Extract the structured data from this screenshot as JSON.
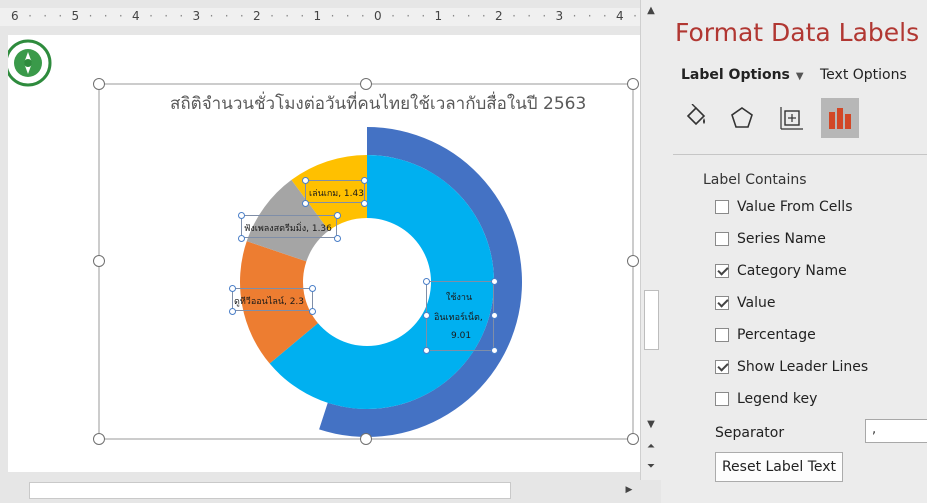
{
  "ruler": {
    "labels": [
      "6",
      "5",
      "4",
      "3",
      "2",
      "1",
      "0",
      "1",
      "2",
      "3",
      "4"
    ]
  },
  "slide": {
    "title": "สถิติจำนวนชั่วโมงต่อวันที่คนไทยใช้เวลากับสื่อในปี 2563"
  },
  "chart_data": {
    "type": "pie",
    "subtype": "doughnut",
    "title": "สถิติจำนวนชั่วโมงต่อวันที่คนไทยใช้เวลากับสื่อในปี 2563",
    "series": [
      {
        "categories": [
          "ใช้งานอินเทอร์เน็ต",
          "ดูทีวีออนไลน์",
          "ฟังเพลงสตรีมมิ่ง",
          "เล่นเกม"
        ],
        "values": [
          9.01,
          2.3,
          1.36,
          1.43
        ],
        "colors": [
          "#00b0f0",
          "#ed7d31",
          "#a5a5a5",
          "#ffc000"
        ]
      },
      {
        "name": "",
        "values": [
          1
        ],
        "colors": [
          "#4472c4"
        ],
        "fraction": 0.55
      }
    ],
    "data_labels": [
      {
        "line1": "ใช้งาน",
        "line2": "อินเทอร์เน็ต,",
        "line3": "9.01"
      },
      {
        "text": "ดูทีวีออนไลน์, 2.3"
      },
      {
        "text": "ฟังเพลงสตรีมมิ่ง, 1.36"
      },
      {
        "text": "เล่นเกม, 1.43"
      }
    ]
  },
  "pane": {
    "title": "Format Data Labels",
    "tabs": {
      "label_options": "Label Options",
      "text_options": "Text Options"
    },
    "label_contains": "Label Contains",
    "options": [
      {
        "label": "Value From Cells",
        "checked": false
      },
      {
        "label": "Series Name",
        "checked": false
      },
      {
        "label": "Category Name",
        "checked": true
      },
      {
        "label": "Value",
        "checked": true
      },
      {
        "label": "Percentage",
        "checked": false
      },
      {
        "label": "Show Leader Lines",
        "checked": true
      },
      {
        "label": "Legend key",
        "checked": false
      }
    ],
    "separator_label": "Separator",
    "separator_value": ",",
    "reset_button": "Reset Label Text"
  }
}
